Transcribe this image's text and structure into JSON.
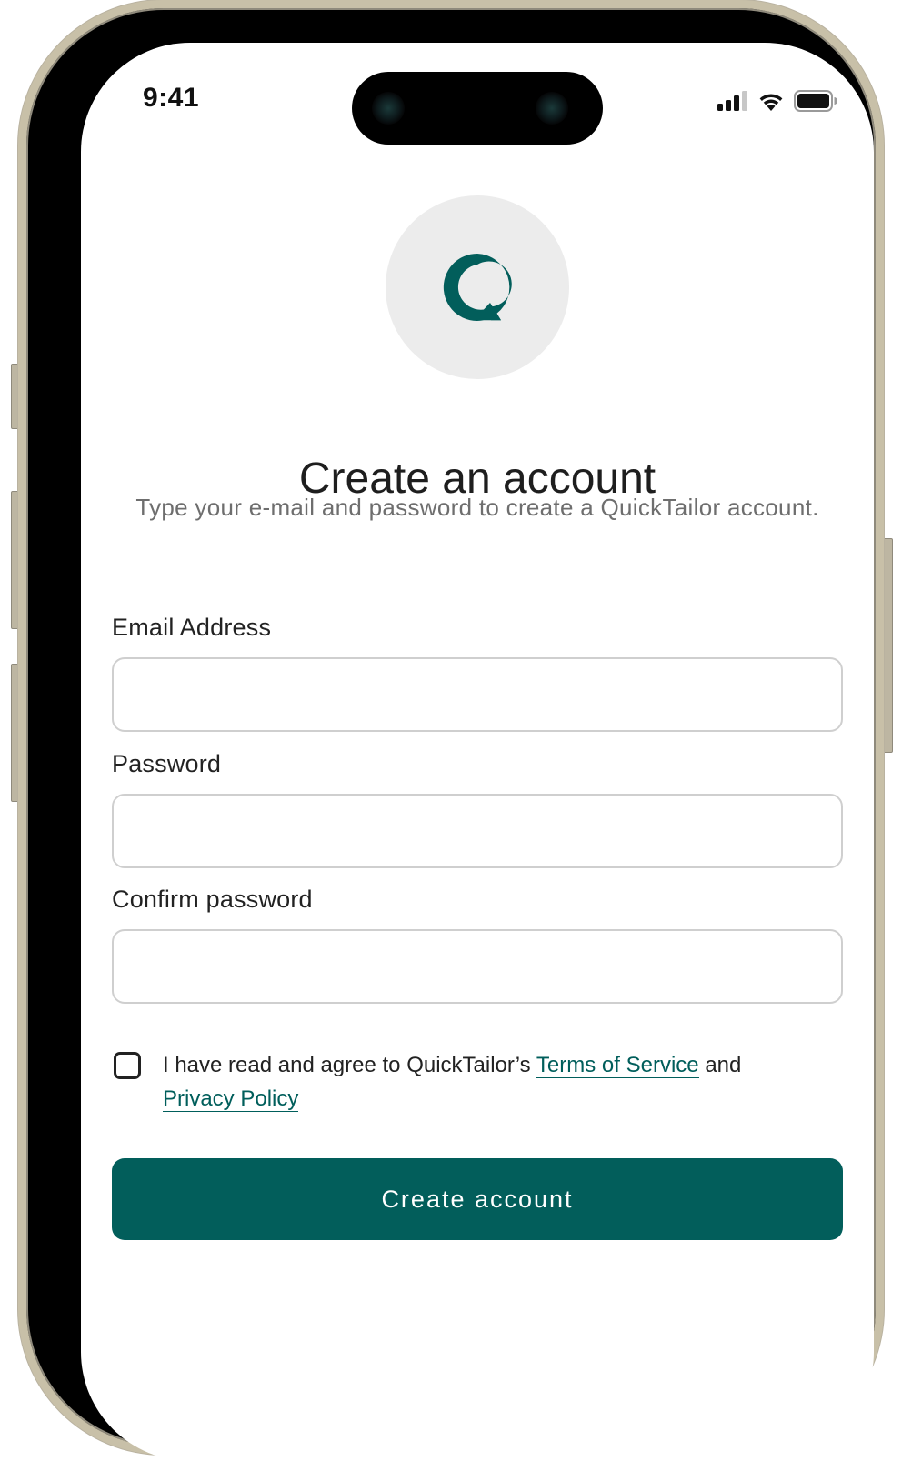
{
  "status_bar": {
    "time": "9:41",
    "icons": [
      "cellular-signal-icon",
      "wifi-icon",
      "battery-icon"
    ]
  },
  "brand": {
    "logo_icon": "quicktailor-logo-icon",
    "accent_color": "#025e5b"
  },
  "header": {
    "title": "Create an account",
    "subtitle": "Type your e-mail and password to create a QuickTailor account."
  },
  "form": {
    "email": {
      "label": "Email Address",
      "value": "",
      "placeholder": ""
    },
    "password": {
      "label": "Password",
      "value": "",
      "placeholder": ""
    },
    "confirm_password": {
      "label": "Confirm password",
      "value": "",
      "placeholder": ""
    },
    "agreement": {
      "checked": false,
      "text_before": "I have read and agree to QuickTailor’s",
      "terms_link": "Terms of Service",
      "text_middle": "and",
      "privacy_link": "Privacy Policy"
    },
    "submit_label": "Create account"
  }
}
